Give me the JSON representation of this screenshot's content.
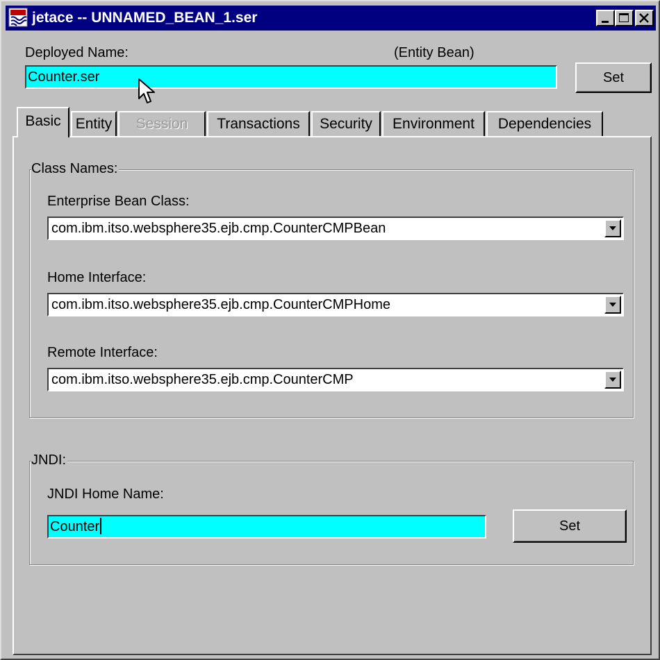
{
  "window": {
    "title": "jetace -- UNNAMED_BEAN_1.ser",
    "minimize_label": "minimize",
    "maximize_label": "maximize",
    "close_label": "close"
  },
  "header": {
    "deployed_name_label": "Deployed Name:",
    "bean_type": "(Entity Bean)",
    "deployed_name_value": "Counter.ser",
    "set_label": "Set"
  },
  "tabs": [
    {
      "label": "Basic",
      "selected": true,
      "enabled": true
    },
    {
      "label": "Entity",
      "selected": false,
      "enabled": true
    },
    {
      "label": "Session",
      "selected": false,
      "enabled": false
    },
    {
      "label": "Transactions",
      "selected": false,
      "enabled": true
    },
    {
      "label": "Security",
      "selected": false,
      "enabled": true
    },
    {
      "label": "Environment",
      "selected": false,
      "enabled": true
    },
    {
      "label": "Dependencies",
      "selected": false,
      "enabled": true
    }
  ],
  "class_names": {
    "title": "Class Names:",
    "enterprise_bean_class_label": "Enterprise Bean Class:",
    "enterprise_bean_class_value": "com.ibm.itso.websphere35.ejb.cmp.CounterCMPBean",
    "home_interface_label": "Home Interface:",
    "home_interface_value": "com.ibm.itso.websphere35.ejb.cmp.CounterCMPHome",
    "remote_interface_label": "Remote Interface:",
    "remote_interface_value": "com.ibm.itso.websphere35.ejb.cmp.CounterCMP"
  },
  "jndi": {
    "title": "JNDI:",
    "home_name_label": "JNDI Home Name:",
    "home_name_value": "Counter",
    "set_label": "Set"
  },
  "colors": {
    "titlebar": "#000080",
    "field_highlight": "#00ffff",
    "face": "#c0c0c0"
  },
  "icons": [
    "app-icon",
    "minimize-icon",
    "maximize-icon",
    "close-icon",
    "dropdown-arrow-icon",
    "mouse-pointer-icon"
  ]
}
